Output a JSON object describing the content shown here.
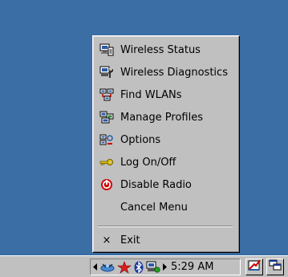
{
  "menu": {
    "items": [
      {
        "label": "Wireless Status",
        "icon": "wireless-status-icon"
      },
      {
        "label": "Wireless Diagnostics",
        "icon": "wireless-diagnostics-icon"
      },
      {
        "label": "Find WLANs",
        "icon": "find-wlans-icon"
      },
      {
        "label": "Manage Profiles",
        "icon": "manage-profiles-icon"
      },
      {
        "label": "Options",
        "icon": "options-icon"
      },
      {
        "label": "Log On/Off",
        "icon": "key-icon"
      },
      {
        "label": "Disable Radio",
        "icon": "power-off-icon"
      },
      {
        "label": "Cancel Menu",
        "icon": ""
      }
    ],
    "exit": {
      "label": "Exit",
      "glyph": "×"
    }
  },
  "taskbar": {
    "clock": "5:29 AM",
    "tray_icons": [
      "arrow-left-icon",
      "network-icon",
      "red-star-icon",
      "bluetooth-icon",
      "wireless-tray-icon",
      "arrow-right-icon"
    ],
    "buttons": [
      "desktop-toggle-icon",
      "windows-switch-icon"
    ]
  },
  "colors": {
    "desktop": "#3a6ea5",
    "menu_bg": "#c0c0c0",
    "disable_radio": "#d00000"
  }
}
